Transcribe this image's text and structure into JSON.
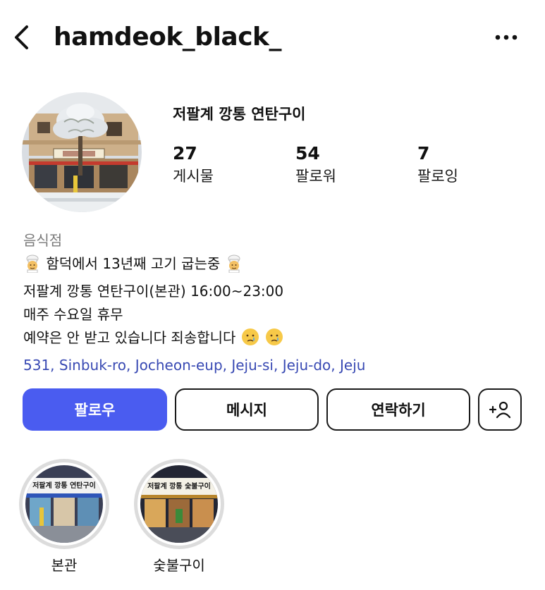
{
  "header": {
    "username": "hamdeok_black_",
    "back_icon": "chevron-left-icon",
    "more_icon": "more-horizontal-icon"
  },
  "profile": {
    "display_name": "저팔계 깡통 연탄구이",
    "stats": [
      {
        "value": "27",
        "label": "게시물"
      },
      {
        "value": "54",
        "label": "팔로워"
      },
      {
        "value": "7",
        "label": "팔로잉"
      }
    ]
  },
  "bio": {
    "category": "음식점",
    "line1": "함덕에서 13년째 고기 굽는중",
    "line2": "저팔계 깡통 연탄구이(본관) 16:00~23:00",
    "line3": "매주 수요일 휴무",
    "line4": "예약은 안 받고 있습니다 죄송합니다",
    "address": "531, Sinbuk-ro, Jocheon-eup, Jeju-si, Jeju-do, Jeju",
    "line1_emoji": "cook-emoji",
    "line4_emoji": "crying-face-emoji"
  },
  "actions": {
    "follow": "팔로우",
    "message": "메시지",
    "contact": "연락하기",
    "add_user_icon": "add-person-icon"
  },
  "highlights": [
    {
      "label": "본관",
      "sign_text": "저팔계 깡통 연탄구이"
    },
    {
      "label": "숯불구이",
      "sign_text": "저팔계 깡통 숯불구이"
    }
  ],
  "colors": {
    "accent": "#4a5cf0",
    "link": "#3849b3",
    "muted": "#7a7a7a"
  }
}
